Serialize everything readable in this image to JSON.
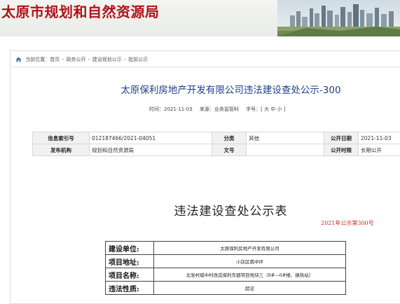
{
  "header": {
    "site_title": "太原市规划和自然资源局"
  },
  "breadcrumb": {
    "items": [
      "当前位置：首页",
      "政务公开",
      "建设规划公示",
      "批前公示"
    ],
    "separator": "›"
  },
  "document": {
    "title": "太原保利房地产开发有限公司违法建设查处公示-300",
    "meta": {
      "time_label": "时间：",
      "time_value": "2021-11-03",
      "source_label": "来源：",
      "source_value": "业务监管科",
      "font_label": "字号：",
      "font_options": "[ 大 中 小 ]"
    }
  },
  "info_table": {
    "index_no_label": "信息索引号",
    "index_no_value": "012187466/2021-04051",
    "category_label": "分类",
    "category_value": "其他",
    "publish_date_label": "公开日期",
    "publish_date_value": "2021-11-03",
    "agency_label": "发布机构",
    "agency_value": "规划和自然资源局",
    "doc_no_label": "文号",
    "doc_no_value": "",
    "duration_label": "公开时限",
    "duration_value": "长期公开"
  },
  "notice": {
    "heading": "违法建设查处公示表",
    "number": "2021年公示第300号",
    "rows": [
      {
        "label": "建设单位:",
        "value": "太原保利房地产开发有限公司"
      },
      {
        "label": "项目地址:",
        "value": "小店区南中环"
      },
      {
        "label": "项目名称:",
        "value": "北张村城中村改造保利东郡项目地块三（8#—6#楼、换热站）"
      },
      {
        "label": "违法性质:",
        "value": "超证"
      }
    ]
  },
  "colors": {
    "site_title": "#b2121a",
    "doc_title": "#1f3f86",
    "doc_number": "#c0302a"
  }
}
